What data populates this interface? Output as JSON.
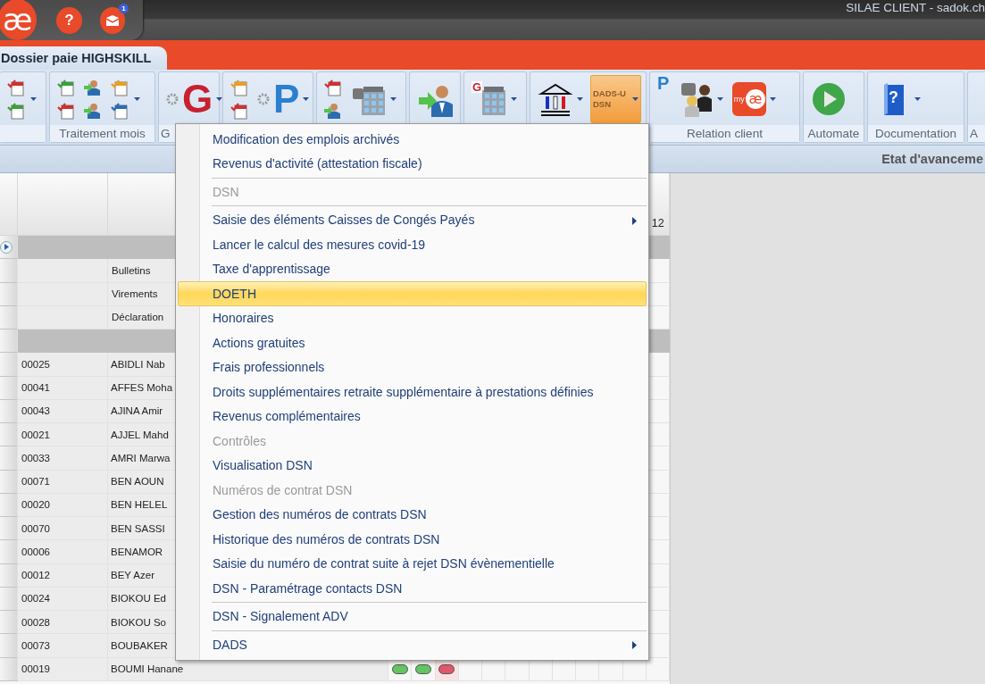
{
  "titlebar": {
    "logo": "æ",
    "help": "?",
    "mail_badge": "1",
    "title": "SILAE CLIENT - sadok.ch"
  },
  "tab": {
    "label": "Dossier paie HIGHSKILL",
    "selected": true
  },
  "ribbon": {
    "groups": [
      {
        "buttons": [
          {
            "kind": "pair",
            "dropdown": true
          }
        ]
      },
      {
        "label": "Traitement mois",
        "buttons": [
          {
            "kind": "grid",
            "dropdown": true
          }
        ]
      },
      {
        "label": "G",
        "buttons": [
          {
            "kind": "glyph",
            "glyph": "G",
            "dropdown": true
          }
        ]
      },
      {
        "buttons": [
          {
            "kind": "pair",
            "dropdown": false
          },
          {
            "kind": "glyph",
            "glyph": "P",
            "dropdown": true
          }
        ]
      },
      {
        "buttons": [
          {
            "kind": "pair",
            "dropdown": false
          },
          {
            "kind": "large",
            "dropdown": true
          }
        ]
      },
      {
        "buttons": [
          {
            "kind": "large",
            "dropdown": false
          }
        ]
      },
      {
        "buttons": [
          {
            "kind": "large",
            "glyph": "G",
            "dropdown": true
          }
        ]
      },
      {
        "buttons": [
          {
            "kind": "large",
            "dropdown": true
          },
          {
            "kind": "text",
            "label": "DADS-U DSN",
            "selected": true,
            "dropdown": true
          }
        ]
      },
      {
        "label": "Relation client",
        "buttons": [
          {
            "kind": "small",
            "glyph": "P",
            "dropdown": false
          },
          {
            "kind": "large",
            "dropdown": true
          },
          {
            "kind": "app",
            "glyph": "my",
            "logo": "æ",
            "dropdown": true
          }
        ]
      },
      {
        "label": "Automate",
        "buttons": [
          {
            "kind": "large",
            "dropdown": false
          }
        ]
      },
      {
        "label": "Documentation",
        "buttons": [
          {
            "kind": "large",
            "glyph": "?",
            "dropdown": true
          }
        ]
      },
      {
        "label": "A"
      }
    ]
  },
  "panel_title": "Etat d'avanceme",
  "grid": {
    "heading": "12",
    "rows": [
      {
        "kind": "expander"
      },
      {
        "kind": "label",
        "label": "Bulletins"
      },
      {
        "kind": "label",
        "label": "Virements"
      },
      {
        "kind": "label",
        "label": "Déclaration"
      },
      {
        "kind": "group"
      },
      {
        "kind": "employee",
        "code": "00025",
        "name": "ABIDLI Nab"
      },
      {
        "kind": "employee",
        "code": "00041",
        "name": "AFFES Moha"
      },
      {
        "kind": "employee",
        "code": "00043",
        "name": "AJINA Amir"
      },
      {
        "kind": "employee",
        "code": "00021",
        "name": "AJJEL Mahd"
      },
      {
        "kind": "employee",
        "code": "00033",
        "name": "AMRI Marwa"
      },
      {
        "kind": "employee",
        "code": "00071",
        "name": "BEN AOUN"
      },
      {
        "kind": "employee",
        "code": "00020",
        "name": "BEN HELEL"
      },
      {
        "kind": "employee",
        "code": "00070",
        "name": "BEN SASSI"
      },
      {
        "kind": "employee",
        "code": "00006",
        "name": "BENAMOR"
      },
      {
        "kind": "employee",
        "code": "00012",
        "name": "BEY Azer"
      },
      {
        "kind": "employee",
        "code": "00024",
        "name": "BIOKOU Ed"
      },
      {
        "kind": "employee",
        "code": "00028",
        "name": "BIOKOU So"
      },
      {
        "kind": "employee",
        "code": "00073",
        "name": "BOUBAKER"
      },
      {
        "kind": "employee",
        "code": "00019",
        "name": "BOUMI Hanane",
        "statuses": [
          {
            "color": "#62c462"
          },
          {
            "color": "#62c462"
          },
          {
            "color": "#e0566a"
          }
        ]
      }
    ]
  },
  "menu": {
    "items": [
      {
        "kind": "item",
        "label": "Modification des emplois archivés",
        "selected": false,
        "disabled": false,
        "submenu": false
      },
      {
        "kind": "item",
        "label": "Revenus d'activité (attestation fiscale)",
        "selected": false,
        "disabled": false,
        "submenu": false
      },
      {
        "kind": "separator"
      },
      {
        "kind": "item",
        "label": "DSN",
        "selected": false,
        "disabled": true,
        "submenu": false
      },
      {
        "kind": "separator"
      },
      {
        "kind": "item",
        "label": "Saisie des éléments Caisses de Congés Payés",
        "selected": false,
        "disabled": false,
        "submenu": true
      },
      {
        "kind": "item",
        "label": "Lancer le calcul des mesures covid-19",
        "selected": false,
        "disabled": false,
        "submenu": false
      },
      {
        "kind": "item",
        "label": "Taxe d'apprentissage",
        "selected": false,
        "disabled": false,
        "submenu": false
      },
      {
        "kind": "item",
        "label": "DOETH",
        "selected": true,
        "disabled": false,
        "submenu": false
      },
      {
        "kind": "item",
        "label": "Honoraires",
        "selected": false,
        "disabled": false,
        "submenu": false
      },
      {
        "kind": "item",
        "label": "Actions gratuites",
        "selected": false,
        "disabled": false,
        "submenu": false
      },
      {
        "kind": "item",
        "label": "Frais professionnels",
        "selected": false,
        "disabled": false,
        "submenu": false
      },
      {
        "kind": "item",
        "label": "Droits supplémentaires retraite supplémentaire à prestations définies",
        "selected": false,
        "disabled": false,
        "submenu": false
      },
      {
        "kind": "item",
        "label": "Revenus complémentaires",
        "selected": false,
        "disabled": false,
        "submenu": false
      },
      {
        "kind": "item",
        "label": "Contrôles",
        "selected": false,
        "disabled": true,
        "submenu": false
      },
      {
        "kind": "item",
        "label": "Visualisation DSN",
        "selected": false,
        "disabled": false,
        "submenu": false
      },
      {
        "kind": "item",
        "label": "Numéros de contrat DSN",
        "selected": false,
        "disabled": true,
        "submenu": false
      },
      {
        "kind": "item",
        "label": "Gestion des numéros de contrats DSN",
        "selected": false,
        "disabled": false,
        "submenu": false
      },
      {
        "kind": "item",
        "label": "Historique des numéros de contrats DSN",
        "selected": false,
        "disabled": false,
        "submenu": false
      },
      {
        "kind": "item",
        "label": "Saisie du numéro de contrat suite à rejet DSN évènementielle",
        "selected": false,
        "disabled": false,
        "submenu": false
      },
      {
        "kind": "item",
        "label": "DSN - Paramétrage contacts DSN",
        "selected": false,
        "disabled": false,
        "submenu": false
      },
      {
        "kind": "separator"
      },
      {
        "kind": "item",
        "label": "DSN - Signalement ADV",
        "selected": false,
        "disabled": false,
        "submenu": false
      },
      {
        "kind": "separator"
      },
      {
        "kind": "item",
        "label": "DADS",
        "selected": false,
        "disabled": false,
        "submenu": true
      }
    ]
  }
}
